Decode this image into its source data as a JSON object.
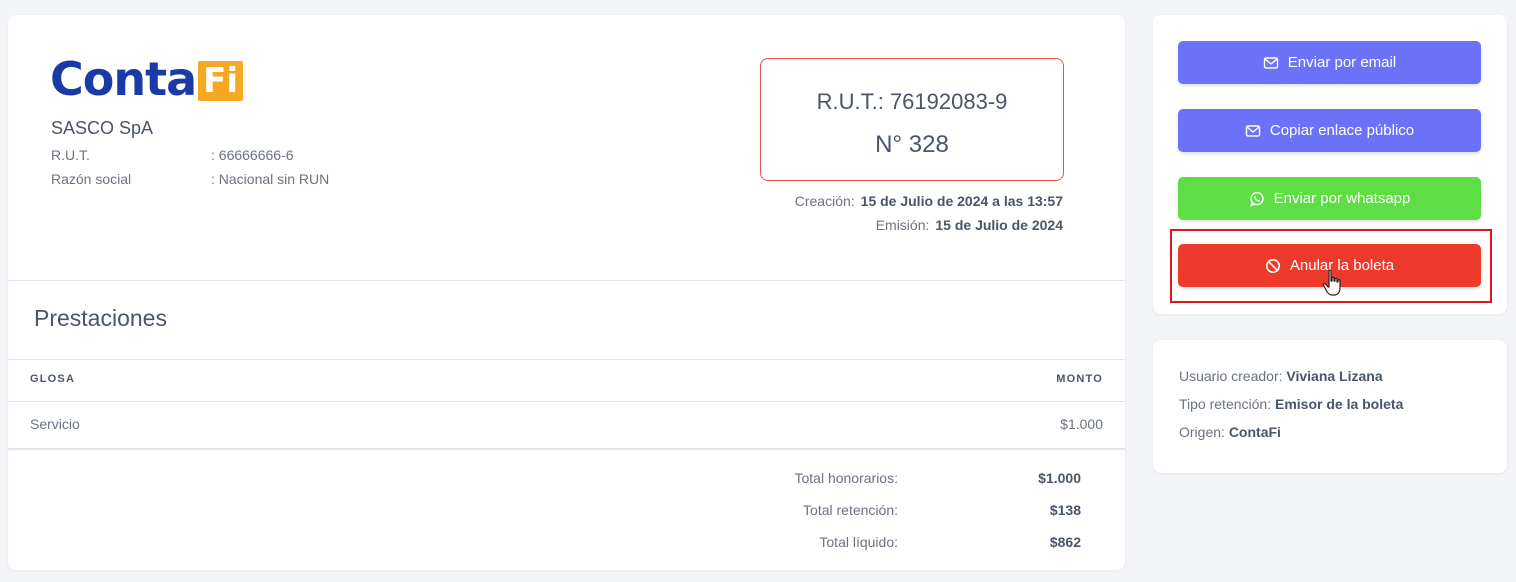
{
  "company": {
    "logo_part1": "Conta",
    "logo_part2": "Fi",
    "name": "SASCO SpA",
    "rut_label": "R.U.T.",
    "rut_value": ": 66666666-6",
    "razon_label": "Razón social",
    "razon_value": ": Nacional sin RUN"
  },
  "document": {
    "rut_line": "R.U.T.: 76192083-9",
    "number_line": "N° 328",
    "creacion_label": "Creación:",
    "creacion_value": "15 de Julio de 2024 a las 13:57",
    "emision_label": "Emisión:",
    "emision_value": "15 de Julio de 2024"
  },
  "prestaciones": {
    "title": "Prestaciones",
    "col_glosa": "GLOSA",
    "col_monto": "MONTO",
    "rows": [
      {
        "glosa": "Servicio",
        "monto": "$1.000"
      }
    ]
  },
  "totals": [
    {
      "label": "Total honorarios:",
      "value": "$1.000"
    },
    {
      "label": "Total retención:",
      "value": "$138"
    },
    {
      "label": "Total líquido:",
      "value": "$862"
    }
  ],
  "actions": {
    "email": {
      "label": "Enviar por email",
      "icon": "envelope-icon"
    },
    "copy_link": {
      "label": "Copiar enlace público",
      "icon": "envelope-icon"
    },
    "whatsapp": {
      "label": "Enviar por whatsapp",
      "icon": "whatsapp-icon"
    },
    "annul": {
      "label": "Anular la boleta",
      "icon": "ban-icon"
    }
  },
  "info": {
    "creator_label": "Usuario creador:",
    "creator_value": "Viviana Lizana",
    "retention_label": "Tipo retención:",
    "retention_value": "Emisor de la boleta",
    "origin_label": "Origen:",
    "origin_value": "ContaFi"
  },
  "colors": {
    "brand_blue": "#1a3aa8",
    "brand_orange": "#f7a823",
    "button_blue": "#6c72f8",
    "button_green": "#5dde45",
    "button_red": "#ee3a2a",
    "highlight": "#e0141c"
  }
}
